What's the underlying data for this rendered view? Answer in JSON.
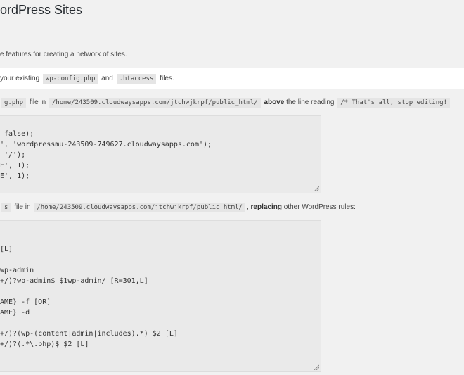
{
  "page": {
    "title": "ordPress Sites",
    "intro": "e features for creating a network of sites."
  },
  "notice": {
    "prefix": "your existing",
    "file1": "wp-config.php",
    "and": "and",
    "file2": ".htaccess",
    "suffix": "files."
  },
  "step1": {
    "file_tail": "g.php",
    "file_in": "file in",
    "path": "/home/243509.cloudwaysapps.com/jtchwjkrpf/public_html/",
    "above": "above",
    "line_reading": "the line reading",
    "marker": "/* That's all, stop editing!",
    "code_lines": [
      " false);",
      "', 'wordpressmu-243509-749627.cloudwaysapps.com');",
      " '/');",
      "E', 1);",
      "E', 1);"
    ]
  },
  "step2": {
    "file_tail": "s",
    "file_in": "file in",
    "path": "/home/243509.cloudwaysapps.com/jtchwjkrpf/public_html/",
    "replacing": "replacing",
    "other_rules": "other WordPress rules:",
    "code_lines": [
      "[L]",
      "wp-admin",
      "+/)?wp-admin$ $1wp-admin/ [R=301,L]",
      "AME} -f [OR]",
      "AME} -d",
      "+/)?(wp-(content|admin|includes).*) $2 [L]",
      "+/)?(.*\\.php)$ $2 [L]"
    ]
  }
}
